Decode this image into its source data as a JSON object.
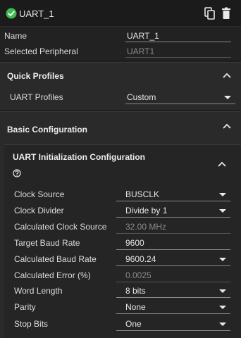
{
  "header": {
    "title": "UART_1",
    "check_icon": "check-circle-icon",
    "copy_icon": "copy-icon",
    "delete_icon": "delete-icon",
    "accent_color": "#3fb950"
  },
  "top_fields": {
    "name_label": "Name",
    "name_value": "UART_1",
    "peripheral_label": "Selected Peripheral",
    "peripheral_value": "UART1"
  },
  "quick_profiles": {
    "title": "Quick Profiles",
    "profiles_label": "UART Profiles",
    "profiles_value": "Custom"
  },
  "basic_config": {
    "title": "Basic Configuration",
    "init_title": "UART Initialization Configuration",
    "rows": [
      {
        "label": "Clock Source",
        "value": "BUSCLK",
        "type": "select"
      },
      {
        "label": "Clock Divider",
        "value": "Divide by 1",
        "type": "select"
      },
      {
        "label": "Calculated Clock Source",
        "value": "32.00 MHz",
        "type": "readonly"
      },
      {
        "label": "Target Baud Rate",
        "value": "9600",
        "type": "input"
      },
      {
        "label": "Calculated Baud Rate",
        "value": "9600.24",
        "type": "select"
      },
      {
        "label": "Calculated Error (%)",
        "value": "0.0025",
        "type": "readonly"
      },
      {
        "label": "Word Length",
        "value": "8 bits",
        "type": "select"
      },
      {
        "label": "Parity",
        "value": "None",
        "type": "select"
      },
      {
        "label": "Stop Bits",
        "value": "One",
        "type": "select"
      }
    ]
  }
}
